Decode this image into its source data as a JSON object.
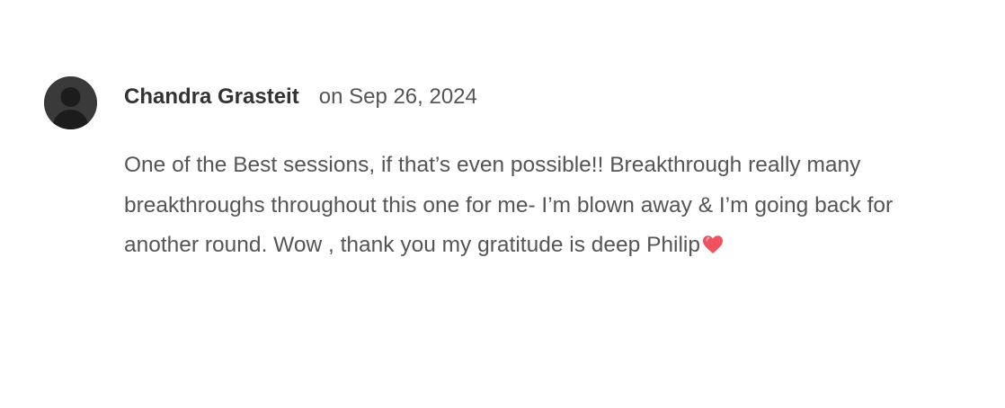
{
  "review": {
    "author": "Chandra Grasteit",
    "date": "on Sep 26, 2024",
    "body": "One of the Best sessions, if that’s even possible!! Breakthrough really many breakthroughs throughout this one for me- I’m blown away & I’m going back for another round. Wow , thank you my gratitude is deep Philip",
    "avatar_icon": "default-user-avatar-icon",
    "emoji_icon": "red-heart-icon",
    "colors": {
      "heart": "#f0525f",
      "avatar_bg": "#3a3a3a"
    }
  }
}
